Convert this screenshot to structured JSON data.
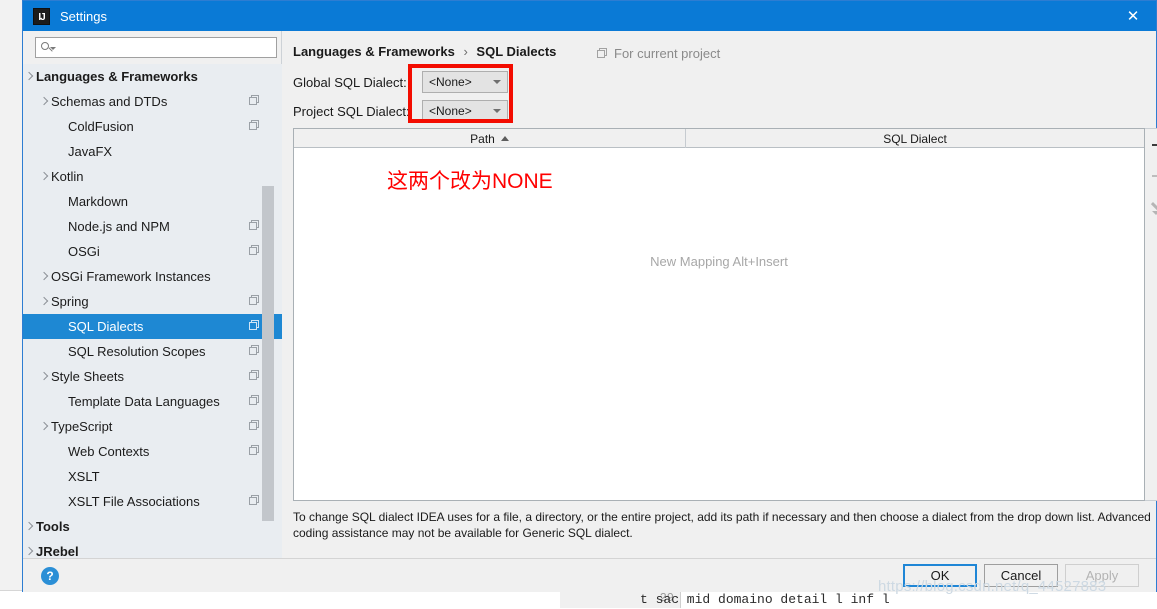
{
  "window": {
    "title": "Settings",
    "app_icon": "IJ",
    "close_icon": "✕",
    "accent_color": "#0a7ad6"
  },
  "search": {
    "value": "",
    "placeholder": "",
    "icon": "search-icon"
  },
  "sidebar": {
    "items": [
      {
        "label": "Languages & Frameworks",
        "chevron": "open",
        "bold": true,
        "indent": 12,
        "project_icon": false,
        "selected": false
      },
      {
        "label": "Schemas and DTDs",
        "chevron": "closed",
        "bold": false,
        "indent": 28,
        "project_icon": true,
        "selected": false
      },
      {
        "label": "ColdFusion",
        "chevron": "none",
        "bold": false,
        "indent": 45,
        "project_icon": true,
        "selected": false
      },
      {
        "label": "JavaFX",
        "chevron": "none",
        "bold": false,
        "indent": 45,
        "project_icon": false,
        "selected": false
      },
      {
        "label": "Kotlin",
        "chevron": "closed",
        "bold": false,
        "indent": 28,
        "project_icon": false,
        "selected": false
      },
      {
        "label": "Markdown",
        "chevron": "none",
        "bold": false,
        "indent": 45,
        "project_icon": false,
        "selected": false
      },
      {
        "label": "Node.js and NPM",
        "chevron": "none",
        "bold": false,
        "indent": 45,
        "project_icon": true,
        "selected": false
      },
      {
        "label": "OSGi",
        "chevron": "none",
        "bold": false,
        "indent": 45,
        "project_icon": true,
        "selected": false
      },
      {
        "label": "OSGi Framework Instances",
        "chevron": "closed",
        "bold": false,
        "indent": 28,
        "project_icon": false,
        "selected": false
      },
      {
        "label": "Spring",
        "chevron": "closed",
        "bold": false,
        "indent": 28,
        "project_icon": true,
        "selected": false
      },
      {
        "label": "SQL Dialects",
        "chevron": "none",
        "bold": false,
        "indent": 45,
        "project_icon": true,
        "selected": true
      },
      {
        "label": "SQL Resolution Scopes",
        "chevron": "none",
        "bold": false,
        "indent": 45,
        "project_icon": true,
        "selected": false
      },
      {
        "label": "Style Sheets",
        "chevron": "closed",
        "bold": false,
        "indent": 28,
        "project_icon": true,
        "selected": false
      },
      {
        "label": "Template Data Languages",
        "chevron": "none",
        "bold": false,
        "indent": 45,
        "project_icon": true,
        "selected": false
      },
      {
        "label": "TypeScript",
        "chevron": "closed",
        "bold": false,
        "indent": 28,
        "project_icon": true,
        "selected": false
      },
      {
        "label": "Web Contexts",
        "chevron": "none",
        "bold": false,
        "indent": 45,
        "project_icon": true,
        "selected": false
      },
      {
        "label": "XSLT",
        "chevron": "none",
        "bold": false,
        "indent": 45,
        "project_icon": false,
        "selected": false
      },
      {
        "label": "XSLT File Associations",
        "chevron": "none",
        "bold": false,
        "indent": 45,
        "project_icon": true,
        "selected": false
      },
      {
        "label": "Tools",
        "chevron": "closed",
        "bold": true,
        "indent": 12,
        "project_icon": false,
        "selected": false
      },
      {
        "label": "JRebel",
        "chevron": "closed",
        "bold": true,
        "indent": 12,
        "project_icon": false,
        "selected": false
      }
    ]
  },
  "content": {
    "breadcrumb_root": "Languages & Frameworks",
    "breadcrumb_sep": "›",
    "breadcrumb_leaf": "SQL Dialects",
    "for_current_project": "For current project",
    "global_label": "Global SQL Dialect:",
    "global_value": "<None>",
    "project_label": "Project SQL Dialect:",
    "project_value": "<None>",
    "annotation": "这两个改为NONE",
    "annotation_color": "#ff0000",
    "highlight_color": "#f30c00",
    "table": {
      "columns": [
        "Path",
        "SQL Dialect"
      ],
      "sort_column": "Path",
      "sort_direction": "asc",
      "rows": [],
      "empty_text": "New Mapping Alt+Insert"
    },
    "tools": {
      "add": "+",
      "remove": "−",
      "edit": "edit-pencil"
    },
    "help_text": "To change SQL dialect IDEA uses for a file, a directory, or the entire project, add its path if necessary and then choose a dialect from the drop down list. Advanced coding assistance may not be available for Generic SQL dialect."
  },
  "footer": {
    "help": "?",
    "ok": "OK",
    "cancel": "Cancel",
    "apply": "Apply"
  },
  "watermark": "https://blog.csdn.net/q_44527883",
  "background": {
    "code_line": "t sac mid domaino detail l inf l",
    "line_number": "29"
  }
}
